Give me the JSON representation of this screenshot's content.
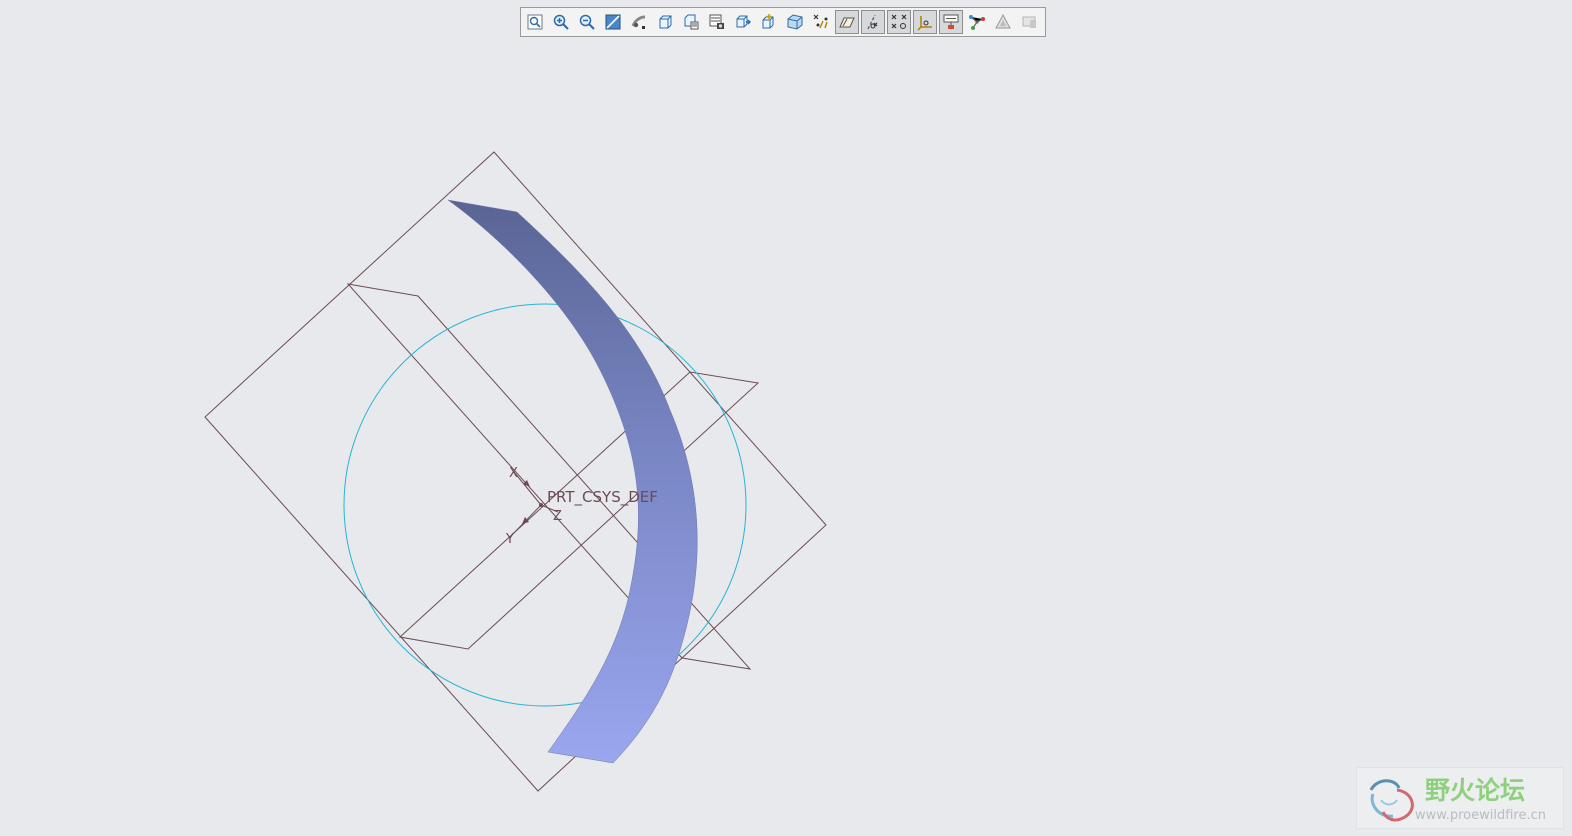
{
  "toolbar": {
    "buttons": [
      {
        "name": "refit-icon",
        "pressed": false
      },
      {
        "name": "zoom-in-icon",
        "pressed": false
      },
      {
        "name": "zoom-out-icon",
        "pressed": false
      },
      {
        "name": "repaint-icon",
        "pressed": false
      },
      {
        "name": "spin-center-icon",
        "pressed": false
      },
      {
        "name": "orient-mode-icon",
        "pressed": false
      },
      {
        "name": "saved-views-icon",
        "pressed": false
      },
      {
        "name": "view-manager-icon",
        "pressed": false
      },
      {
        "name": "layers-icon",
        "pressed": false
      },
      {
        "name": "reorient-icon",
        "pressed": false
      },
      {
        "name": "display-style-icon",
        "pressed": false
      },
      {
        "name": "datum-display-filters-icon",
        "pressed": false
      },
      {
        "name": "plane-display-icon",
        "pressed": true
      },
      {
        "name": "axis-display-icon",
        "pressed": true
      },
      {
        "name": "point-display-icon",
        "pressed": true
      },
      {
        "name": "csys-display-icon",
        "pressed": true
      },
      {
        "name": "annotation-display-icon",
        "pressed": true
      },
      {
        "name": "network-icon",
        "pressed": false
      },
      {
        "name": "shading-icon",
        "pressed": false
      },
      {
        "name": "text-style-icon",
        "pressed": false
      }
    ]
  },
  "viewport": {
    "csys_label": "PRT_CSYS_DEF",
    "axis_x": "X",
    "axis_y": "Y",
    "axis_z": "Z",
    "colors": {
      "datum": "#6b4b55",
      "sketch_circle": "#27b4d6",
      "surface_top": "#5a6494",
      "surface_bottom": "#9aa6ee"
    }
  },
  "watermark": {
    "title": "野火论坛",
    "url": "www.proewildfire.cn"
  }
}
